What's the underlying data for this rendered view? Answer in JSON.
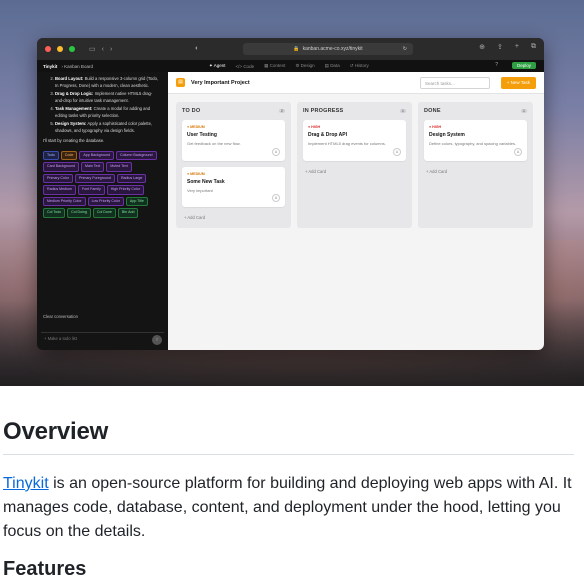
{
  "browser": {
    "url": "kanban.acme-co.xyz/tinykit"
  },
  "appbar": {
    "brand": "Tinykit",
    "breadcrumb": "Kanban Board",
    "tabs": [
      "Agent",
      "Code",
      "Content",
      "Design",
      "Data",
      "History"
    ],
    "active_tab": "Agent",
    "deploy": "Deploy"
  },
  "chat": {
    "items": [
      {
        "title": "Board Layout:",
        "text": "Build a responsive 3-column grid (Todo, In Progress, Done) with a modern, clean aesthetic."
      },
      {
        "title": "Drag & Drop Logic:",
        "text": "Implement native HTML5 drag-and-drop for intuitive task management."
      },
      {
        "title": "Task Management:",
        "text": "Create a modal for adding and editing tasks with priority selection."
      },
      {
        "title": "Design System:",
        "text": "Apply a sophisticated color palette, shadows, and typography via design fields."
      }
    ],
    "after": "I'll start by creating the database.",
    "chips": [
      {
        "label": "Todo",
        "kind": "b"
      },
      {
        "label": "Code",
        "kind": "o"
      },
      {
        "label": "App Background",
        "kind": "p"
      },
      {
        "label": "Column Background",
        "kind": "p"
      },
      {
        "label": "Card Background",
        "kind": "p"
      },
      {
        "label": "Main Text",
        "kind": "p"
      },
      {
        "label": "Muted Text",
        "kind": "p"
      },
      {
        "label": "Primary Color",
        "kind": "p"
      },
      {
        "label": "Primary Foreground",
        "kind": "p"
      },
      {
        "label": "Radius Large",
        "kind": "p"
      },
      {
        "label": "Radius Medium",
        "kind": "p"
      },
      {
        "label": "Font Family",
        "kind": "p"
      },
      {
        "label": "High Priority Color",
        "kind": "p"
      },
      {
        "label": "Medium Priority Color",
        "kind": "p"
      },
      {
        "label": "Low Priority Color",
        "kind": "p"
      },
      {
        "label": "App Title",
        "kind": "g"
      },
      {
        "label": "Col Todo",
        "kind": "g"
      },
      {
        "label": "Col Doing",
        "kind": "g"
      },
      {
        "label": "Col Done",
        "kind": "g"
      },
      {
        "label": "Btn Add",
        "kind": "g"
      }
    ],
    "clear": "Clear conversation",
    "placeholder": "Make a todo list"
  },
  "project": {
    "title": "Very Important Project",
    "search_placeholder": "Search tasks...",
    "new_task": "+ New Task"
  },
  "columns": [
    {
      "title": "TO DO",
      "count": "2",
      "cards": [
        {
          "priority": "MEDIUM",
          "level": "med",
          "title": "User Testing",
          "desc": "Get feedback on the new flow."
        },
        {
          "priority": "MEDIUM",
          "level": "med",
          "title": "Some New Task",
          "desc": "Very important"
        }
      ]
    },
    {
      "title": "IN PROGRESS",
      "count": "1",
      "cards": [
        {
          "priority": "HIGH",
          "level": "high",
          "title": "Drag & Drop API",
          "desc": "Implement HTML5 drag events for columns."
        }
      ]
    },
    {
      "title": "DONE",
      "count": "1",
      "cards": [
        {
          "priority": "HIGH",
          "level": "high",
          "title": "Design System",
          "desc": "Define colors, typography, and spacing variables."
        }
      ]
    }
  ],
  "add_card": "+ Add Card",
  "readme": {
    "heading": "Overview",
    "link": "Tinykit",
    "text": " is an open-source platform for building and deploying web apps with AI. It manages code, database, content, and deployment under the hood, letting you focus on the details.",
    "features": "Features"
  },
  "colors": {
    "accent": "#f59e0b",
    "deploy": "#2ea043",
    "link": "#0969da",
    "high": "#dc2626",
    "medium": "#d97706"
  }
}
